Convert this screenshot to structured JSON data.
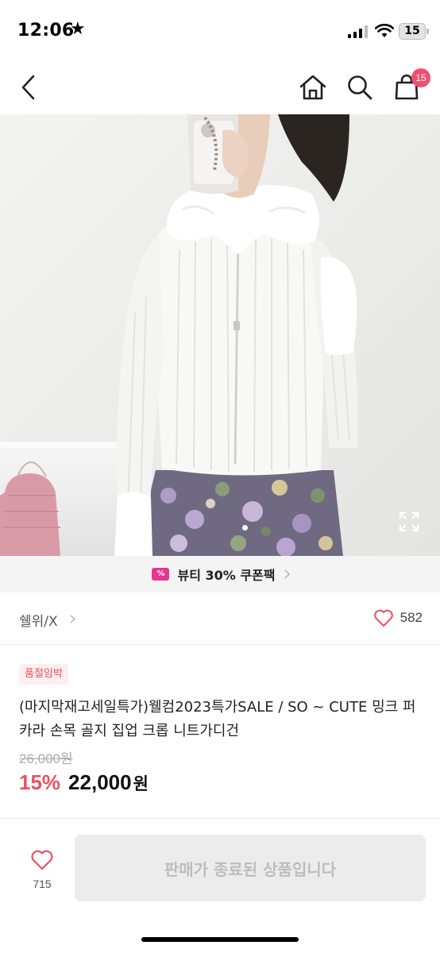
{
  "status_bar": {
    "time": "12:06",
    "battery": "15"
  },
  "nav": {
    "cart_badge": "15"
  },
  "coupon": {
    "icon_glyph": "%",
    "text": "뷰티 30% 쿠폰팩"
  },
  "shop": {
    "name": "쉘위/X",
    "like_count": "582"
  },
  "product": {
    "badge": "품절임박",
    "title": "(마지막재고세일특가)웰컴2023특가SALE / SO ~ CUTE  밍크 퍼 카라 손목 골지 집업 크롭 니트가디건",
    "original_price": "26,000원",
    "discount": "15%",
    "price": "22,000",
    "currency": "원"
  },
  "bottom_bar": {
    "wish_count": "715",
    "ended_label": "판매가 종료된 상품입니다"
  },
  "colors": {
    "accent": "#f04e62",
    "badge": "#f0506e",
    "coupon": "#e8358f"
  }
}
